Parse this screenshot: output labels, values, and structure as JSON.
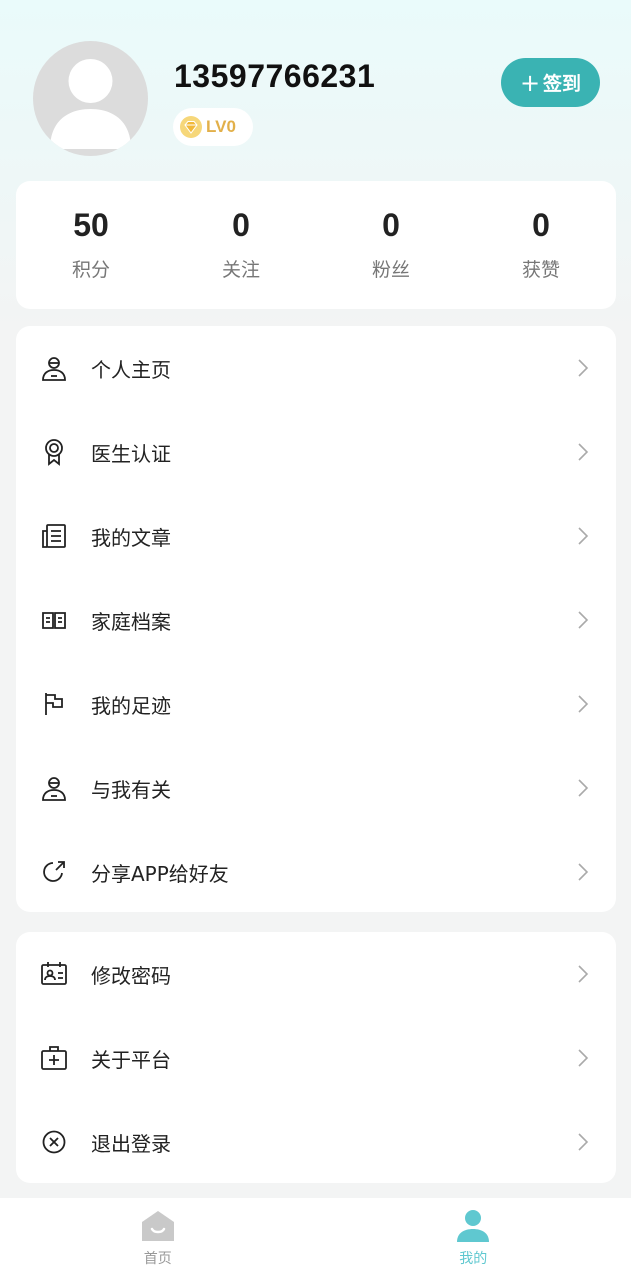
{
  "profile": {
    "phone": "13597766231",
    "level": "LV0",
    "signin_plus": "+",
    "signin_label": "签到"
  },
  "stats": [
    {
      "value": "50",
      "label": "积分"
    },
    {
      "value": "0",
      "label": "关注"
    },
    {
      "value": "0",
      "label": "粉丝"
    },
    {
      "value": "0",
      "label": "获赞"
    }
  ],
  "menu": {
    "group1": [
      {
        "label": "个人主页",
        "icon": "user-icon"
      },
      {
        "label": "医生认证",
        "icon": "award-badge-icon"
      },
      {
        "label": "我的文章",
        "icon": "document-icon"
      },
      {
        "label": "家庭档案",
        "icon": "open-book-icon"
      },
      {
        "label": "我的足迹",
        "icon": "flag-icon"
      },
      {
        "label": "与我有关",
        "icon": "user-icon"
      },
      {
        "label": "分享APP给好友",
        "icon": "share-icon"
      }
    ],
    "group2": [
      {
        "label": "修改密码",
        "icon": "id-card-icon"
      },
      {
        "label": "关于平台",
        "icon": "medical-kit-icon"
      },
      {
        "label": "退出登录",
        "icon": "close-circle-icon"
      }
    ]
  },
  "tabbar": {
    "home": "首页",
    "mine": "我的"
  },
  "colors": {
    "accent": "#3ab3b3",
    "tab_active": "#5fc8d0",
    "level_gold": "#e2b04a"
  }
}
